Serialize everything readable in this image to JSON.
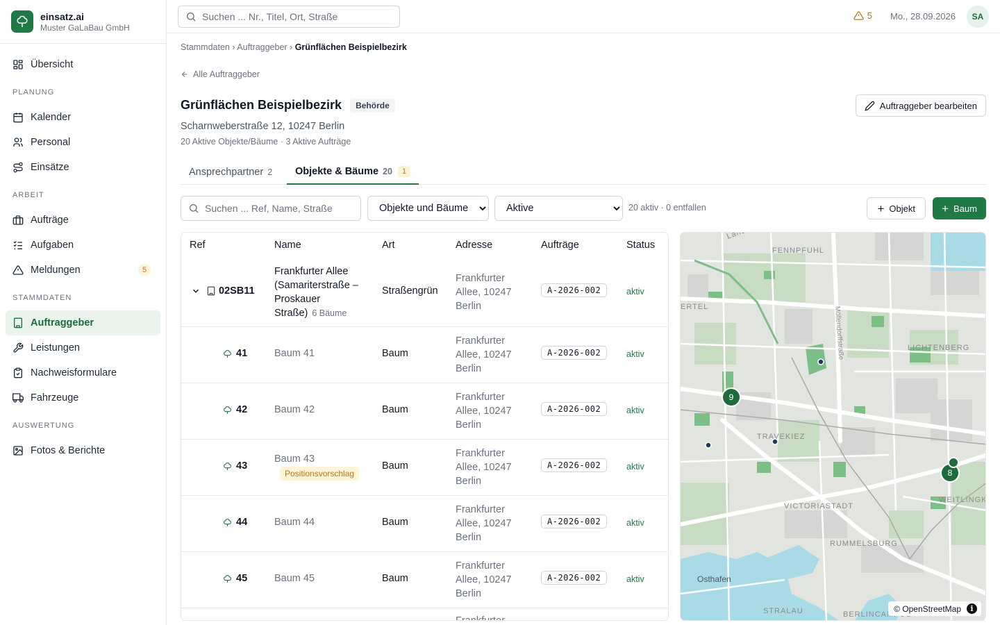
{
  "brand": {
    "name": "einsatz.ai",
    "org": "Muster GaLaBau GmbH"
  },
  "sidebar": {
    "overview": "Übersicht",
    "sections": {
      "planung": "PLANUNG",
      "arbeit": "ARBEIT",
      "stammdaten": "STAMMDATEN",
      "auswertung": "AUSWERTUNG"
    },
    "items": {
      "kalender": "Kalender",
      "personal": "Personal",
      "einsaetze": "Einsätze",
      "auftraege": "Aufträge",
      "aufgaben": "Aufgaben",
      "meldungen": "Meldungen",
      "meldungen_badge": "5",
      "auftraggeber": "Auftraggeber",
      "leistungen": "Leistungen",
      "nachweisformulare": "Nachweisformulare",
      "fahrzeuge": "Fahrzeuge",
      "fotos": "Fotos & Berichte"
    }
  },
  "topbar": {
    "search_placeholder": "Suchen ... Nr., Titel, Ort, Straße",
    "warnings": "5",
    "date": "Mo., 28.09.2026",
    "avatar": "SA"
  },
  "breadcrumb": {
    "part1": "Stammdaten",
    "sep": " › ",
    "part2": "Auftraggeber",
    "current": "Grünflächen Beispielbezirk"
  },
  "backlink": "Alle Auftraggeber",
  "client": {
    "name": "Grünflächen Beispielbezirk",
    "type": "Behörde",
    "address": "Scharnweberstraße 12, 10247 Berlin",
    "meta": "20 Aktive Objekte/Bäume · 3 Aktive Aufträge",
    "edit_label": "Auftraggeber bearbeiten"
  },
  "tabs": {
    "contacts": {
      "label": "Ansprechpartner",
      "count": "2"
    },
    "objects": {
      "label": "Objekte & Bäume",
      "count": "20",
      "pending": "1"
    }
  },
  "filters": {
    "search_placeholder": "Suchen ... Ref, Name, Straße",
    "type_selected": "Objekte und Bäume",
    "status_selected": "Aktive",
    "summary": "20 aktiv · 0 entfallen",
    "add_object": "Objekt",
    "add_tree": "Baum"
  },
  "table": {
    "columns": {
      "ref": "Ref",
      "name": "Name",
      "type": "Art",
      "address": "Adresse",
      "orders": "Aufträge",
      "status": "Status"
    },
    "parent": {
      "ref": "02SB11",
      "name_lines": [
        "Frankfurter Allee",
        "(Samariterstraße –",
        "Proskauer"
      ],
      "name_last": "Straße)",
      "subcount": "6 Bäume",
      "type": "Straßengrün",
      "address_lines": [
        "Frankfurter",
        "Allee, 10247",
        "Berlin"
      ],
      "order": "A-2026-002",
      "status": "aktiv"
    },
    "rows": [
      {
        "ref": "41",
        "name": "Baum 41",
        "type": "Baum",
        "address_lines": [
          "Frankfurter",
          "Allee, 10247",
          "Berlin"
        ],
        "order": "A-2026-002",
        "status": "aktiv",
        "suggestion": ""
      },
      {
        "ref": "42",
        "name": "Baum 42",
        "type": "Baum",
        "address_lines": [
          "Frankfurter",
          "Allee, 10247",
          "Berlin"
        ],
        "order": "A-2026-002",
        "status": "aktiv",
        "suggestion": ""
      },
      {
        "ref": "43",
        "name": "Baum 43",
        "type": "Baum",
        "address_lines": [
          "Frankfurter",
          "Allee, 10247",
          "Berlin"
        ],
        "order": "A-2026-002",
        "status": "aktiv",
        "suggestion": "Positionsvorschlag"
      },
      {
        "ref": "44",
        "name": "Baum 44",
        "type": "Baum",
        "address_lines": [
          "Frankfurter",
          "Allee, 10247",
          "Berlin"
        ],
        "order": "A-2026-002",
        "status": "aktiv",
        "suggestion": ""
      },
      {
        "ref": "45",
        "name": "Baum 45",
        "type": "Baum",
        "address_lines": [
          "Frankfurter",
          "Allee, 10247",
          "Berlin"
        ],
        "order": "A-2026-002",
        "status": "aktiv",
        "suggestion": ""
      }
    ],
    "partial_row_text": "Frankfurter"
  },
  "map": {
    "labels": {
      "fennpfuhl": "FENNPFUHL",
      "lichtenberg": "LICHTENBERG",
      "travekiez": "TRAVEKIEZ",
      "victoriastadt": "VICTORIASTADT",
      "weitlingk": "WEITLINGK",
      "rummelsburg": "RUMMELSBURG",
      "osthafen": "Osthafen",
      "stralau": "STRALAU",
      "berlincampus": "BERLINCAMPUS",
      "ertel": "ERTEL",
      "moellendorff": "Möllendorffstraße",
      "landsb": "Land"
    },
    "clusters": {
      "c1": "9",
      "c2": "8"
    },
    "attribution": "© OpenStreetMap",
    "info": "i",
    "colors": {
      "marker": "#1f6b3c",
      "water": "#a8dbe6",
      "park": "#c8dcc4"
    }
  },
  "colors": {
    "accent": "#1f7a45",
    "warning": "#b7791f"
  }
}
